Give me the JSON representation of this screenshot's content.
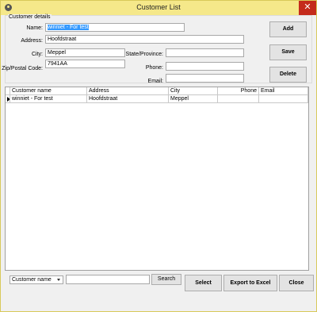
{
  "window": {
    "title": "Customer List",
    "close_glyph": "✕"
  },
  "details": {
    "group_label": "Customer details",
    "name_label": "Name:",
    "name_value": "winniet - For test",
    "address_label": "Address:",
    "address_value": "Hoofdstraat",
    "city_label": "City:",
    "city_value": "Meppel",
    "zip_label": "Zip/Postal Code:",
    "zip_value": "7941AA",
    "state_label": "State/Province:",
    "state_value": "",
    "phone_label": "Phone:",
    "phone_value": "",
    "email_label": "Email:",
    "email_value": ""
  },
  "actions": {
    "add": "Add",
    "save": "Save",
    "delete": "Delete"
  },
  "grid": {
    "columns": [
      "Customer name",
      "Address",
      "City",
      "Phone",
      "Email"
    ],
    "rows": [
      [
        "winniet - For test",
        "Hoofdstraat",
        "Meppel",
        "",
        ""
      ]
    ]
  },
  "search": {
    "field_selected": "Customer name",
    "query": "",
    "search_label": "Search"
  },
  "footer": {
    "select": "Select",
    "export": "Export to Excel",
    "close": "Close"
  },
  "icons": {
    "app": "app-icon",
    "close": "close-icon",
    "row_indicator": "row-selector-icon",
    "dropdown": "chevron-down-icon"
  }
}
